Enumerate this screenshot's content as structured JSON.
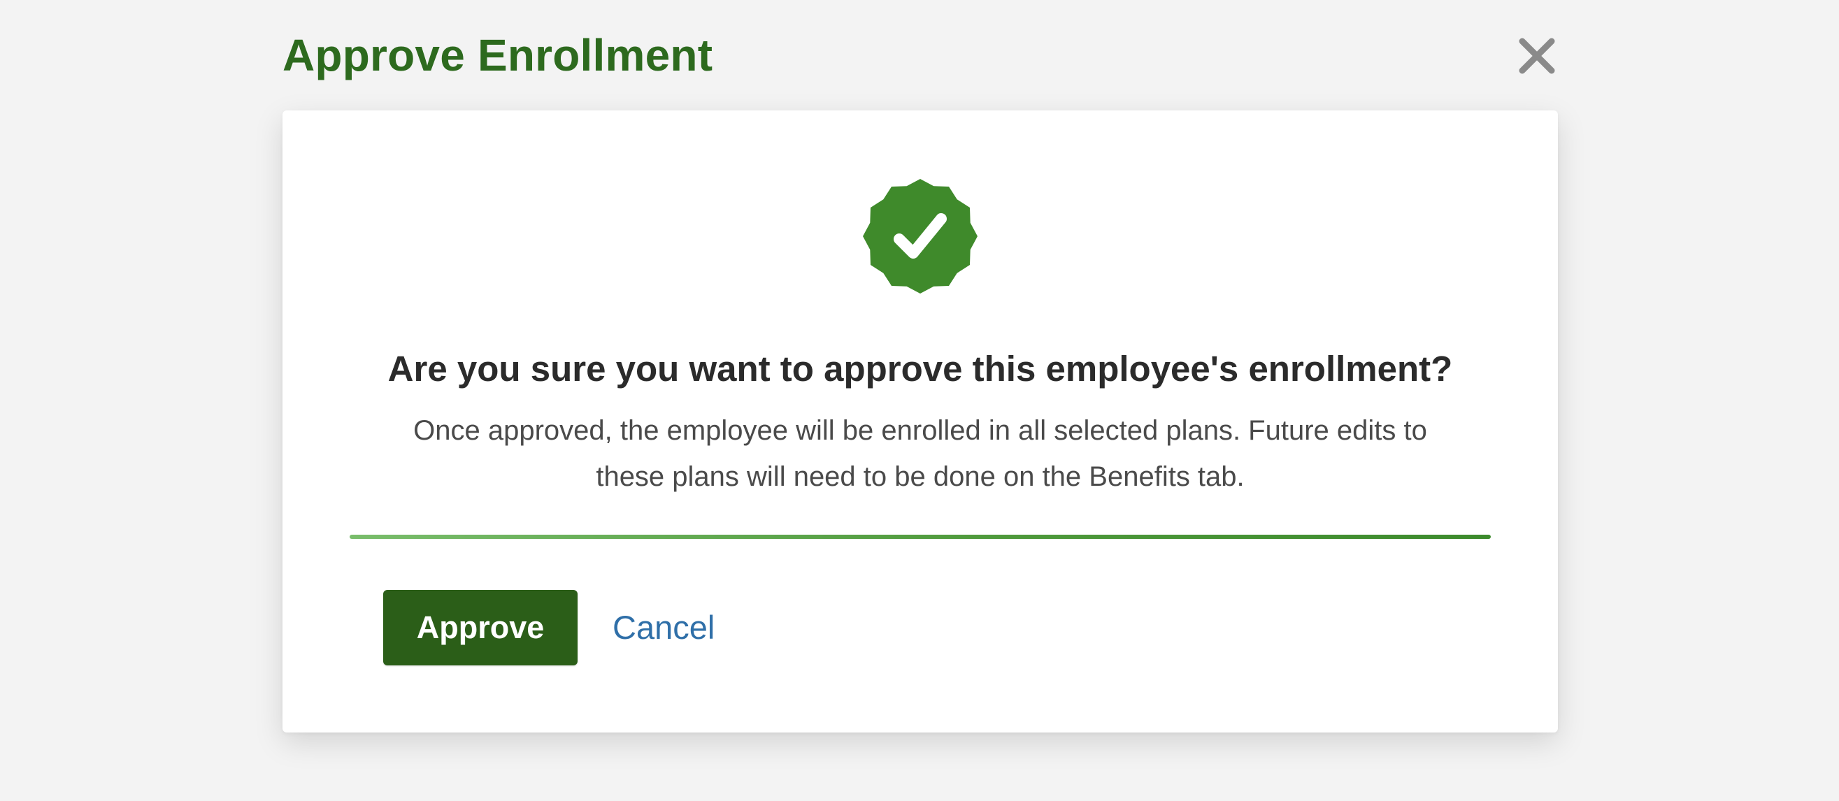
{
  "modal": {
    "title": "Approve Enrollment",
    "close_icon": "close-icon",
    "badge_icon": "verified-badge-check-icon",
    "heading": "Are you sure you want to approve this employee's enrollment?",
    "message": "Once approved, the employee will be enrolled in all selected plans. Future edits to these plans will need to be done on the Benefits tab.",
    "approve_label": "Approve",
    "cancel_label": "Cancel"
  },
  "colors": {
    "title": "#2d6a1e",
    "badge": "#3f8a2b",
    "approve_button": "#2b5e18",
    "cancel_link": "#2f6fa8",
    "divider": "#4f9a3c",
    "close_icon": "#8a8a8a",
    "background": "#f3f3f3"
  }
}
